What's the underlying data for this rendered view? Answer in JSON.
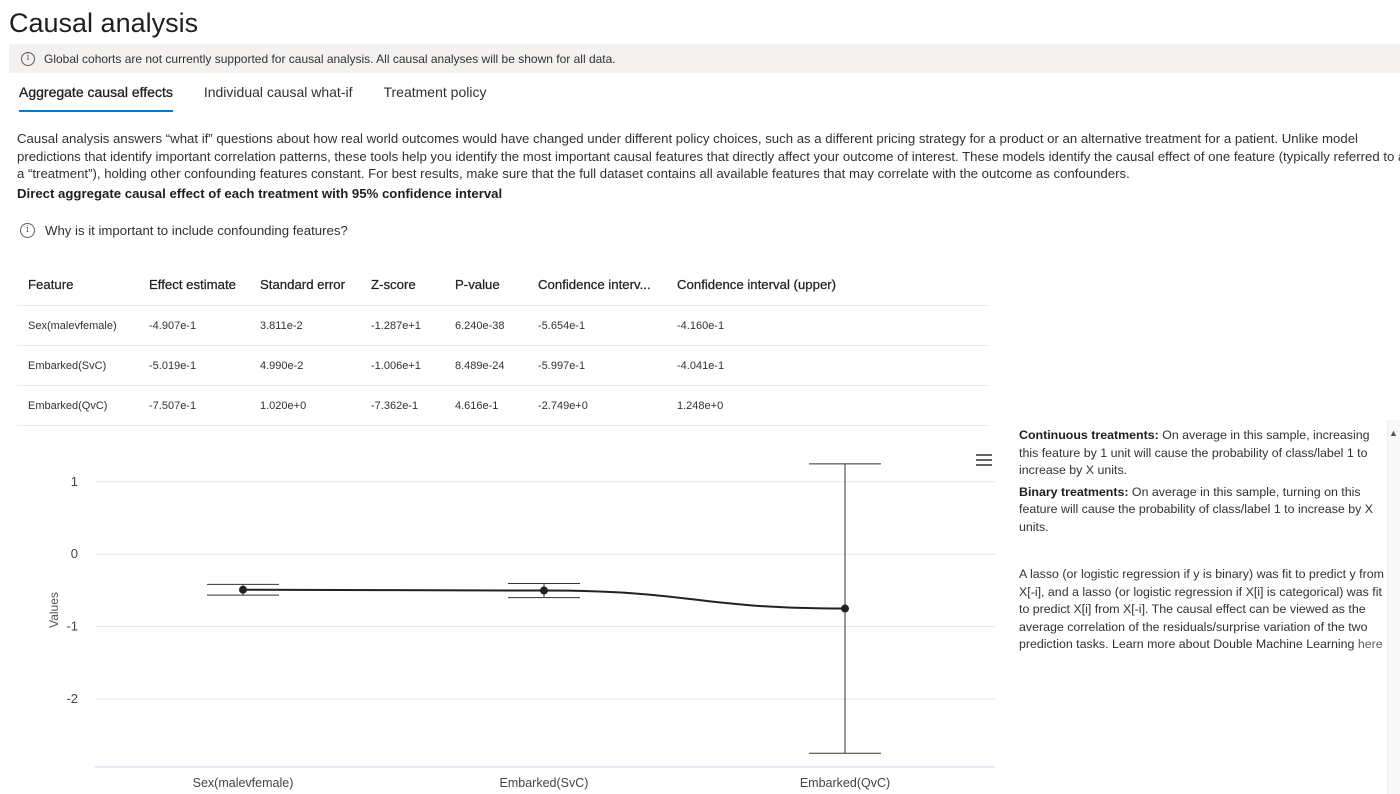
{
  "page": {
    "title": "Causal analysis",
    "banner_text": "Global cohorts are not currently supported for causal analysis. All causal analyses will be shown for all data."
  },
  "tabs": [
    {
      "label": "Aggregate causal effects",
      "active": true
    },
    {
      "label": "Individual causal what-if",
      "active": false
    },
    {
      "label": "Treatment policy",
      "active": false
    }
  ],
  "description": {
    "line1": "Causal analysis answers “what if” questions about how real world outcomes would have changed under different policy choices, such as a different pricing strategy for a product or an alternative treatment for a patient. Unlike model",
    "line2": "predictions that identify important correlation patterns, these tools help you identify the most important causal features that directly affect your outcome of interest. These models identify the causal effect of one feature (typically referred to as",
    "line3": "a “treatment”), holding other confounding features constant. For best results, make sure that the full dataset contains all available features that may correlate with the outcome as confounders."
  },
  "section_heading": "Direct aggregate causal effect of each treatment with 95% confidence interval",
  "why_link": "Why is it important to include confounding features?",
  "table": {
    "headers": [
      "Feature",
      "Effect estimate",
      "Standard error",
      "Z-score",
      "P-value",
      "Confidence interv...",
      "Confidence interval (upper)"
    ],
    "rows": [
      [
        "Sex(malevfemale)",
        "-4.907e-1",
        "3.811e-2",
        "-1.287e+1",
        "6.240e-38",
        "-5.654e-1",
        "-4.160e-1"
      ],
      [
        "Embarked(SvC)",
        "-5.019e-1",
        "4.990e-2",
        "-1.006e+1",
        "8.489e-24",
        "-5.997e-1",
        "-4.041e-1"
      ],
      [
        "Embarked(QvC)",
        "-7.507e-1",
        "1.020e+0",
        "-7.362e-1",
        "4.616e-1",
        "-2.749e+0",
        "1.248e+0"
      ]
    ]
  },
  "chart_data": {
    "type": "line",
    "ylabel": "Values",
    "xlabel": "",
    "categories": [
      "Sex(malevfemale)",
      "Embarked(SvC)",
      "Embarked(QvC)"
    ],
    "values": [
      -0.4907,
      -0.5019,
      -0.7507
    ],
    "lower": [
      -0.5654,
      -0.5997,
      -2.749
    ],
    "upper": [
      -0.416,
      -0.4041,
      1.248
    ],
    "yticks": [
      1,
      0,
      -1,
      -2
    ],
    "ylim": [
      -2.95,
      1.4
    ],
    "grid": true,
    "colors": {
      "line": "#222222",
      "grid": "#e6e6e6",
      "errorbar": "#333333"
    }
  },
  "sidepanel": {
    "continuous_label": "Continuous treatments:",
    "continuous_text": " On average in this sample, increasing this feature by 1 unit will cause the probability of class/label 1 to increase by X units.",
    "binary_label": "Binary treatments:",
    "binary_text": " On average in this sample, turning on this feature will cause the probability of class/label 1 to increase by X units.",
    "lasso_text": "A lasso (or logistic regression if y is binary) was fit to predict y from X[-i], and a lasso (or logistic regression if X[i] is categorical) was fit to predict X[i] from X[-i]. The causal effect can be viewed as the average correlation of the residuals/surprise variation of the two prediction tasks. Learn more about Double Machine Learning ",
    "link_text": "here"
  },
  "icons": {
    "info": "info-icon",
    "menu": "hamburger-icon"
  }
}
